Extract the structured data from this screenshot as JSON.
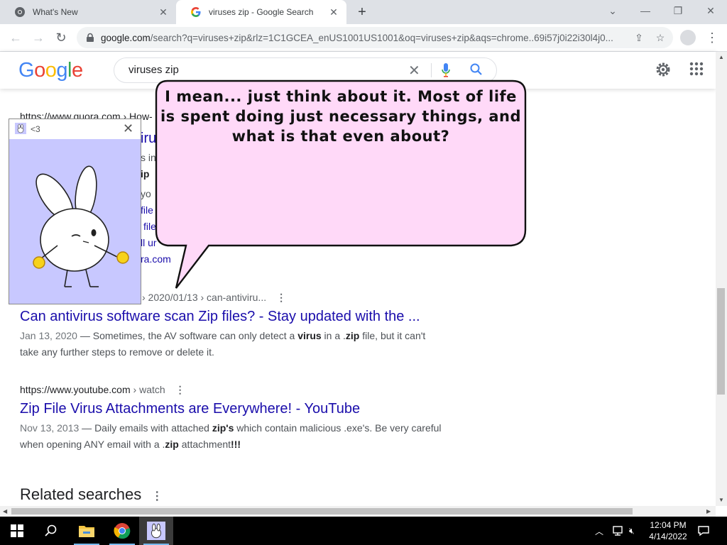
{
  "browser": {
    "tabs": [
      {
        "title": "What's New",
        "icon": "chrome-icon"
      },
      {
        "title": "viruses zip - Google Search",
        "icon": "google-g-icon"
      }
    ],
    "url_host": "google.com",
    "url_path": "/search?q=viruses+zip&rlz=1C1GCEA_enUS1001US1001&oq=viruses+zip&aqs=chrome..69i57j0i22i30l4j0..."
  },
  "google": {
    "logo": "Google",
    "query": "viruses zip",
    "colors": {
      "blue": "#4285F4",
      "red": "#EA4335",
      "yellow": "#FBBC05",
      "green": "#34A853",
      "link": "#1a0dab"
    }
  },
  "partial_result": {
    "cite": "https://www.quora.com › How-",
    "fragments": [
      "iru",
      "s in",
      "ip",
      "yo",
      "file",
      "file",
      "ll ur",
      "ra.com"
    ]
  },
  "results": [
    {
      "cite_crumb": "› 2020/01/13 › can-antiviru...",
      "title": "Can antivirus software scan Zip files? - Stay updated with the ...",
      "date": "Jan 13, 2020",
      "snippet_parts": [
        " — Sometimes, the AV software can only detect a ",
        "virus",
        " in a .",
        "zip",
        " file, but it can't take any further steps to remove or delete it."
      ]
    },
    {
      "cite": "https://www.youtube.com",
      "cite_crumb": "› watch",
      "title": "Zip File Virus Attachments are Everywhere! - YouTube",
      "date": "Nov 13, 2013",
      "snippet_parts": [
        " — Daily emails with attached ",
        "zip's",
        " which contain malicious .exe's. Be very careful when opening ANY email with a .",
        "zip",
        " attachment",
        "!!!"
      ]
    }
  ],
  "related": {
    "title": "Related searches"
  },
  "pet": {
    "title": "<3",
    "bg_color": "#c8c8ff"
  },
  "bubble": {
    "text": "I mean... just think about it. Most of life is spent doing just necessary things, and what is that even about?",
    "fill": "#ffd9f8"
  },
  "taskbar": {
    "time": "12:04 PM",
    "date": "4/14/2022",
    "items": [
      "windows-start-icon",
      "search-icon",
      "file-explorer-icon",
      "chrome-icon",
      "bunny-pet-icon"
    ]
  }
}
